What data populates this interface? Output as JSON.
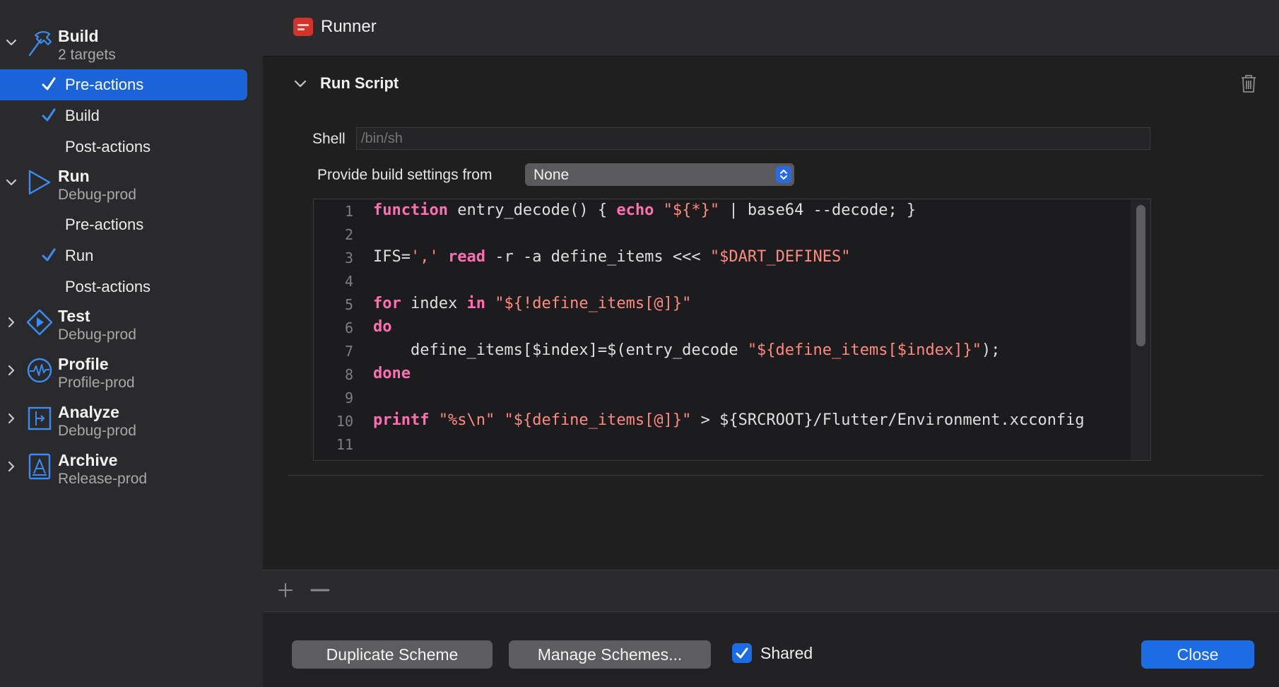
{
  "window": {
    "scheme_title": "Runner"
  },
  "sidebar": {
    "phases": [
      {
        "name": "Build",
        "sub": "2 targets",
        "icon": "hammer-icon",
        "expanded": true
      },
      {
        "name": "Run",
        "sub": "Debug-prod",
        "icon": "play-icon",
        "expanded": true
      },
      {
        "name": "Test",
        "sub": "Debug-prod",
        "icon": "test-diamond-icon",
        "expanded": false
      },
      {
        "name": "Profile",
        "sub": "Profile-prod",
        "icon": "waveform-icon",
        "expanded": false
      },
      {
        "name": "Analyze",
        "sub": "Debug-prod",
        "icon": "analyze-icon",
        "expanded": false
      },
      {
        "name": "Archive",
        "sub": "Release-prod",
        "icon": "archive-icon",
        "expanded": false
      }
    ],
    "build_items": [
      {
        "label": "Pre-actions",
        "checked": true,
        "selected": true
      },
      {
        "label": "Build",
        "checked": true,
        "selected": false
      },
      {
        "label": "Post-actions",
        "checked": false,
        "selected": false
      }
    ],
    "run_items": [
      {
        "label": "Pre-actions",
        "checked": false,
        "selected": false
      },
      {
        "label": "Run",
        "checked": true,
        "selected": false
      },
      {
        "label": "Post-actions",
        "checked": false,
        "selected": false
      }
    ]
  },
  "script": {
    "section_title": "Run Script",
    "shell_label": "Shell",
    "shell_placeholder": "/bin/sh",
    "build_settings_label": "Provide build settings from",
    "build_settings_value": "None",
    "lines": [
      {
        "n": "1",
        "code": "function entry_decode() { echo \"${*}\" | base64 --decode; }"
      },
      {
        "n": "2",
        "code": ""
      },
      {
        "n": "3",
        "code": "IFS=',' read -r -a define_items <<< \"$DART_DEFINES\""
      },
      {
        "n": "4",
        "code": ""
      },
      {
        "n": "5",
        "code": "for index in \"${!define_items[@]}\""
      },
      {
        "n": "6",
        "code": "do"
      },
      {
        "n": "7",
        "code": "    define_items[$index]=$(entry_decode \"${define_items[$index]}\");"
      },
      {
        "n": "8",
        "code": "done"
      },
      {
        "n": "9",
        "code": ""
      },
      {
        "n": "10",
        "code": "printf \"%s\\n\" \"${define_items[@]}\" > ${SRCROOT}/Flutter/Environment.xcconfig"
      },
      {
        "n": "11",
        "code": ""
      }
    ]
  },
  "footer": {
    "duplicate_label": "Duplicate Scheme",
    "manage_label": "Manage Schemes...",
    "shared_label": "Shared",
    "shared_checked": true,
    "close_label": "Close"
  },
  "colors": {
    "accent": "#1c6ce3",
    "selection": "#1b63d8",
    "keyword": "#ff6fb0",
    "string": "#ff8a80",
    "icon_blue": "#3a8cf5"
  }
}
